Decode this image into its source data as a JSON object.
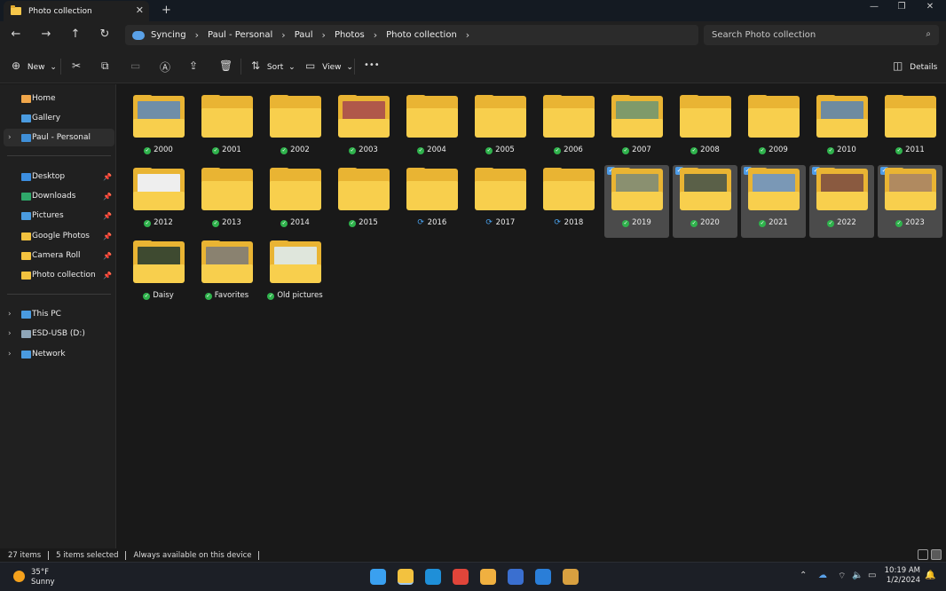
{
  "window": {
    "tab_title": "Photo collection",
    "close_tab": "✕",
    "new_tab": "+",
    "minimize": "—",
    "maximize": "❐",
    "close": "✕"
  },
  "nav": {
    "back": "←",
    "forward": "→",
    "up": "↑",
    "refresh": "↻",
    "breadcrumbs": [
      "Syncing",
      "Paul - Personal",
      "Paul",
      "Photos",
      "Photo collection"
    ],
    "crumb_sep": "›",
    "search_placeholder": "Search Photo collection"
  },
  "toolbar": {
    "new_label": "New",
    "sort_label": "Sort",
    "view_label": "View",
    "more_label": "•••",
    "details_label": "Details"
  },
  "sidebar": {
    "items": [
      {
        "label": "Home",
        "icon": "home-icon",
        "color": "#f0a64a",
        "pinned": false,
        "chevron": false
      },
      {
        "label": "Gallery",
        "icon": "gallery-icon",
        "color": "#4a9be0",
        "pinned": false,
        "chevron": false
      },
      {
        "label": "Paul - Personal",
        "icon": "cloud-icon",
        "color": "#3f8fd8",
        "pinned": false,
        "chevron": true,
        "active": true
      },
      {
        "label": "Desktop",
        "icon": "desktop-icon",
        "color": "#3c8ee0",
        "pinned": true,
        "chevron": false
      },
      {
        "label": "Downloads",
        "icon": "downloads-icon",
        "color": "#2fa86a",
        "pinned": true,
        "chevron": false
      },
      {
        "label": "Pictures",
        "icon": "pictures-icon",
        "color": "#4a9be0",
        "pinned": true,
        "chevron": false
      },
      {
        "label": "Google Photos",
        "icon": "folder-icon",
        "color": "#f3c23f",
        "pinned": true,
        "chevron": false
      },
      {
        "label": "Camera Roll",
        "icon": "folder-icon",
        "color": "#f3c23f",
        "pinned": true,
        "chevron": false
      },
      {
        "label": "Photo collection",
        "icon": "folder-icon",
        "color": "#f3c23f",
        "pinned": true,
        "chevron": false
      },
      {
        "label": "This PC",
        "icon": "pc-icon",
        "color": "#4a9be0",
        "pinned": false,
        "chevron": true
      },
      {
        "label": "ESD-USB (D:)",
        "icon": "usb-drive-icon",
        "color": "#8fa6b8",
        "pinned": false,
        "chevron": true
      },
      {
        "label": "Network",
        "icon": "network-icon",
        "color": "#4a9be0",
        "pinned": false,
        "chevron": true
      }
    ]
  },
  "folders": [
    {
      "name": "2000",
      "status": "synced",
      "thumb": "#6f8ea8",
      "selected": false
    },
    {
      "name": "2001",
      "status": "synced",
      "thumb": null,
      "selected": false
    },
    {
      "name": "2002",
      "status": "synced",
      "thumb": null,
      "selected": false
    },
    {
      "name": "2003",
      "status": "synced",
      "thumb": "#b0584a",
      "selected": false
    },
    {
      "name": "2004",
      "status": "synced",
      "thumb": null,
      "selected": false
    },
    {
      "name": "2005",
      "status": "synced",
      "thumb": null,
      "selected": false
    },
    {
      "name": "2006",
      "status": "synced",
      "thumb": null,
      "selected": false
    },
    {
      "name": "2007",
      "status": "synced",
      "thumb": "#7f9a6a",
      "selected": false
    },
    {
      "name": "2008",
      "status": "synced",
      "thumb": null,
      "selected": false
    },
    {
      "name": "2009",
      "status": "synced",
      "thumb": null,
      "selected": false
    },
    {
      "name": "2010",
      "status": "synced",
      "thumb": "#6e8ba0",
      "selected": false
    },
    {
      "name": "2011",
      "status": "synced",
      "thumb": null,
      "selected": false
    },
    {
      "name": "2012",
      "status": "synced",
      "thumb": "#eeeeee",
      "selected": false
    },
    {
      "name": "2013",
      "status": "synced",
      "thumb": null,
      "selected": false
    },
    {
      "name": "2014",
      "status": "synced",
      "thumb": null,
      "selected": false
    },
    {
      "name": "2015",
      "status": "synced",
      "thumb": null,
      "selected": false
    },
    {
      "name": "2016",
      "status": "syncing",
      "thumb": null,
      "selected": false
    },
    {
      "name": "2017",
      "status": "syncing",
      "thumb": null,
      "selected": false
    },
    {
      "name": "2018",
      "status": "syncing",
      "thumb": null,
      "selected": false
    },
    {
      "name": "2019",
      "status": "synced",
      "thumb": "#8a9070",
      "selected": true
    },
    {
      "name": "2020",
      "status": "synced",
      "thumb": "#5a6048",
      "selected": true
    },
    {
      "name": "2021",
      "status": "synced",
      "thumb": "#7a98b6",
      "selected": true
    },
    {
      "name": "2022",
      "status": "synced",
      "thumb": "#8a5a40",
      "selected": true
    },
    {
      "name": "2023",
      "status": "synced",
      "thumb": "#b08a60",
      "selected": true
    },
    {
      "name": "Daisy",
      "status": "synced",
      "thumb": "#3e4a30",
      "selected": false
    },
    {
      "name": "Favorites",
      "status": "synced",
      "thumb": "#8a8270",
      "selected": false
    },
    {
      "name": "Old pictures",
      "status": "synced",
      "thumb": "#dfe6dc",
      "selected": false
    }
  ],
  "status": {
    "items": "27 items",
    "selected": "5 items selected",
    "availability": "Always available on this device"
  },
  "taskbar": {
    "temp": "35°F",
    "condition": "Sunny",
    "time": "10:19 AM",
    "date": "1/2/2024",
    "apps": [
      {
        "name": "start-button",
        "color": "#3aa0f0"
      },
      {
        "name": "file-explorer-app",
        "color": "#f3c23f"
      },
      {
        "name": "edge-app",
        "color": "#1f8fd8"
      },
      {
        "name": "chrome-app",
        "color": "#e0453a"
      },
      {
        "name": "paint-app",
        "color": "#f0b040"
      },
      {
        "name": "outlook-app",
        "color": "#3a6fd0"
      },
      {
        "name": "remote-app",
        "color": "#2a7ed8"
      },
      {
        "name": "photos-app",
        "color": "#d8a040"
      }
    ]
  },
  "colors": {
    "accent": "#4d9ce8",
    "synced": "#2fb24c",
    "syncing": "#4aa3ef",
    "folder": "#f8cf4d"
  }
}
